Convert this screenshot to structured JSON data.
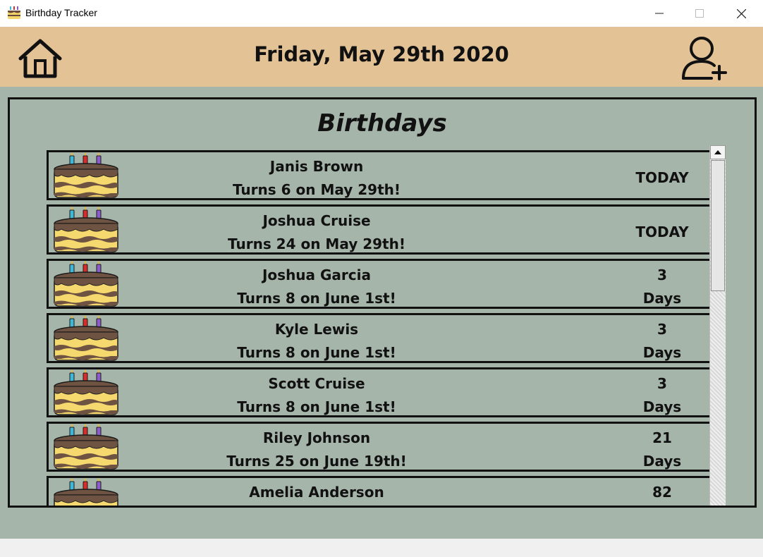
{
  "window": {
    "title": "Birthday Tracker",
    "minimize_icon": "minimize-icon",
    "maximize_icon": "maximize-icon",
    "close_icon": "close-icon"
  },
  "header": {
    "date": "Friday, May 29th 2020",
    "home_icon": "home-icon",
    "add_user_icon": "add-user-icon",
    "background": "#e3c296"
  },
  "main": {
    "background": "#a6b5aa",
    "title": "Birthdays"
  },
  "birthdays": [
    {
      "name": "Janis Brown",
      "turns": "Turns 6 on May 29th!",
      "when": "TODAY"
    },
    {
      "name": "Joshua Cruise",
      "turns": "Turns 24 on May 29th!",
      "when": "TODAY"
    },
    {
      "name": "Joshua Garcia",
      "turns": "Turns 8 on June 1st!",
      "days": "3",
      "days_label": "Days"
    },
    {
      "name": "Kyle Lewis",
      "turns": "Turns 8 on June 1st!",
      "days": "3",
      "days_label": "Days"
    },
    {
      "name": "Scott Cruise",
      "turns": "Turns 8 on June 1st!",
      "days": "3",
      "days_label": "Days"
    },
    {
      "name": "Riley Johnson",
      "turns": "Turns 25 on June 19th!",
      "days": "21",
      "days_label": "Days"
    },
    {
      "name": "Amelia Anderson",
      "turns": "",
      "days": "82",
      "days_label": ""
    }
  ]
}
